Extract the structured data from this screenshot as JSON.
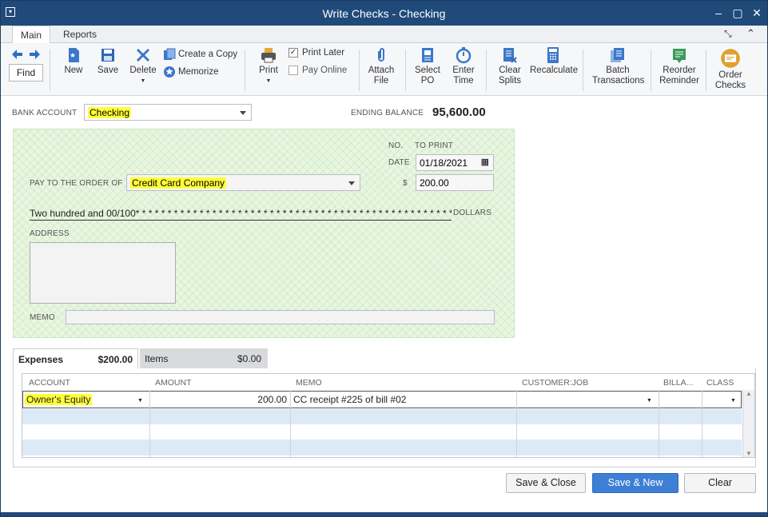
{
  "window": {
    "title": "Write Checks - Checking"
  },
  "tabs": [
    {
      "label": "Main"
    },
    {
      "label": "Reports"
    }
  ],
  "toolbar": {
    "find": "Find",
    "new": "New",
    "save": "Save",
    "delete": "Delete",
    "create_copy": "Create a Copy",
    "memorize": "Memorize",
    "print": "Print",
    "print_later": "Print Later",
    "pay_online": "Pay Online",
    "attach_file": [
      "Attach",
      "File"
    ],
    "select_po": [
      "Select",
      "PO"
    ],
    "enter_time": [
      "Enter",
      "Time"
    ],
    "clear_splits": [
      "Clear",
      "Splits"
    ],
    "recalculate": "Recalculate",
    "batch_transactions": [
      "Batch",
      "Transactions"
    ],
    "reorder_reminder": [
      "Reorder",
      "Reminder"
    ],
    "order_checks": [
      "Order",
      "Checks"
    ]
  },
  "bank": {
    "label": "BANK ACCOUNT",
    "value": "Checking",
    "ending_balance_label": "ENDING BALANCE",
    "ending_balance": "95,600.00"
  },
  "check": {
    "no_label": "NO.",
    "no_value": "TO PRINT",
    "date_label": "DATE",
    "date": "01/18/2021",
    "payee_label": "PAY TO THE ORDER OF",
    "payee": "Credit Card Company",
    "dollar_sign": "$",
    "amount": "200.00",
    "amount_words": "Two hundred and 00/100* * * * * * * * * * * * * * * * * * * * * * * * * * * * * * * * * * * * * * * * * * * * * * * * * * *",
    "dollars_label": "DOLLARS",
    "address_label": "ADDRESS",
    "memo_label": "MEMO"
  },
  "detail_tabs": [
    {
      "label": "Expenses",
      "amount": "$200.00"
    },
    {
      "label": "Items",
      "amount": "$0.00"
    }
  ],
  "grid": {
    "columns": [
      "ACCOUNT",
      "AMOUNT",
      "MEMO",
      "CUSTOMER:JOB",
      "BILLA...",
      "CLASS"
    ],
    "rows": [
      {
        "account": "Owner's Equity",
        "amount": "200.00",
        "memo": "CC receipt #225 of bill #02",
        "customer": "",
        "billable": "",
        "class": ""
      }
    ]
  },
  "buttons": {
    "save_close": "Save & Close",
    "save_new": "Save & New",
    "clear": "Clear"
  },
  "colors": {
    "title_bar": "#1f4a7a",
    "highlight": "#ffff3a",
    "primary_button": "#3e7fd6"
  }
}
